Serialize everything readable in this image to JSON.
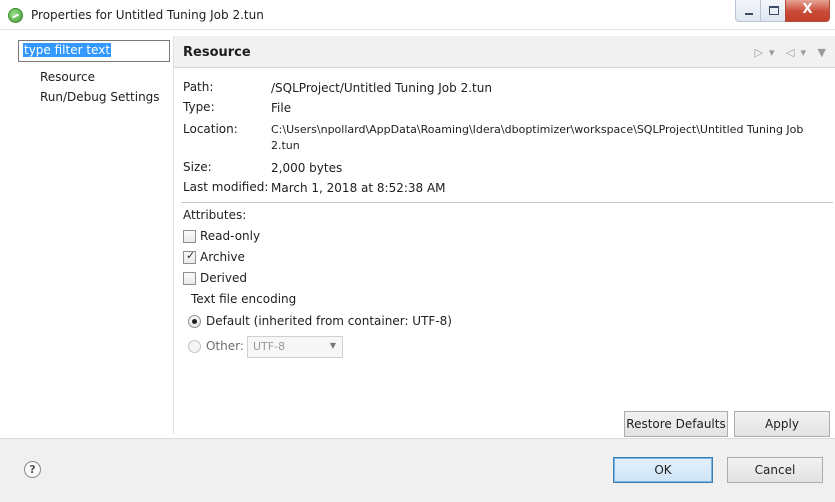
{
  "window": {
    "title": "Properties for Untitled Tuning Job 2.tun",
    "close_glyph": "X"
  },
  "filter": {
    "placeholder": "type filter text"
  },
  "tree": {
    "items": [
      {
        "label": "Resource"
      },
      {
        "label": "Run/Debug Settings"
      }
    ]
  },
  "page": {
    "title": "Resource",
    "nav_icons": [
      "back-arrow-icon",
      "dropdown-icon",
      "forward-arrow-icon",
      "dropdown-icon",
      "view-menu-icon"
    ],
    "properties": {
      "path": {
        "label": "Path:",
        "value": "/SQLProject/Untitled Tuning Job 2.tun"
      },
      "type": {
        "label": "Type:",
        "value": "File"
      },
      "location": {
        "label": "Location:",
        "value": "C:\\Users\\npollard\\AppData\\Roaming\\Idera\\dboptimizer\\workspace\\SQLProject\\Untitled Tuning Job 2.tun"
      },
      "size": {
        "label": "Size:",
        "value": "2,000  bytes"
      },
      "last_modified": {
        "label": "Last modified:",
        "value": "March 1, 2018 at 8:52:38 AM"
      }
    },
    "attributes": {
      "label": "Attributes:",
      "read_only": {
        "label": "Read-only",
        "checked": false
      },
      "archive": {
        "label": "Archive",
        "checked": true
      },
      "derived": {
        "label": "Derived",
        "checked": false
      }
    },
    "encoding": {
      "label": "Text file encoding",
      "default_option": {
        "label": "Default (inherited from container: UTF-8)",
        "selected": true
      },
      "other_option": {
        "label": "Other:",
        "selected": false
      },
      "other_value": "UTF-8"
    },
    "restore_defaults_label": "Restore Defaults",
    "apply_label": "Apply"
  },
  "footer": {
    "help_glyph": "?",
    "ok_label": "OK",
    "cancel_label": "Cancel"
  }
}
